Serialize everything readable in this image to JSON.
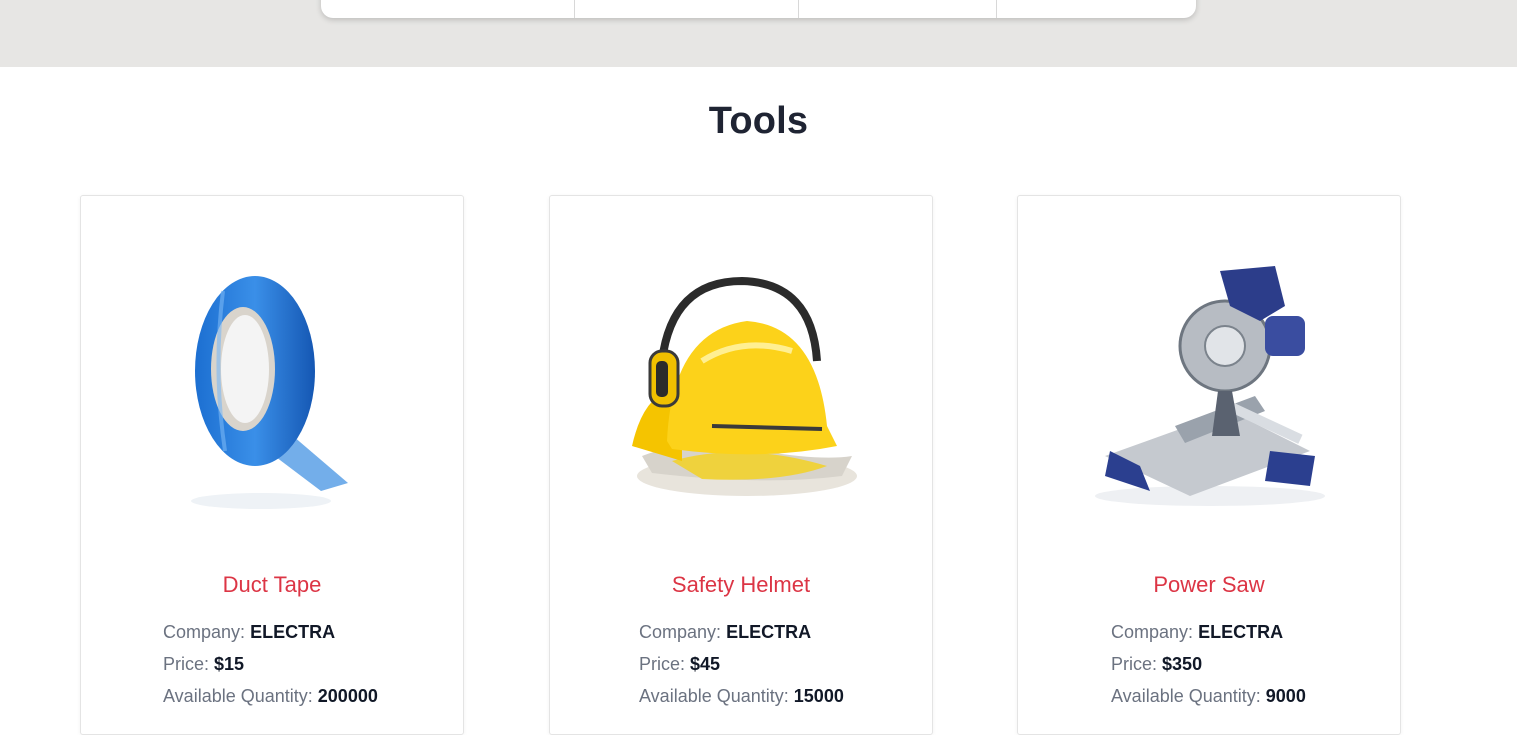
{
  "toolbar": {
    "segments": [
      "",
      "",
      "",
      ""
    ]
  },
  "section": {
    "title": "Tools"
  },
  "products": [
    {
      "name": "Duct Tape",
      "company_label": "Company:",
      "company": "ELECTRA",
      "price_label": "Price:",
      "price": "$15",
      "quantity_label": "Available Quantity:",
      "quantity": "200000",
      "image_icon": "duct-tape-image"
    },
    {
      "name": "Safety Helmet",
      "company_label": "Company:",
      "company": "ELECTRA",
      "price_label": "Price:",
      "price": "$45",
      "quantity_label": "Available Quantity:",
      "quantity": "15000",
      "image_icon": "safety-helmet-image"
    },
    {
      "name": "Power Saw",
      "company_label": "Company:",
      "company": "ELECTRA",
      "price_label": "Price:",
      "price": "$350",
      "quantity_label": "Available Quantity:",
      "quantity": "9000",
      "image_icon": "power-saw-image"
    }
  ],
  "colors": {
    "accent_title": "#dc3545",
    "band_background": "#e7e6e4"
  }
}
